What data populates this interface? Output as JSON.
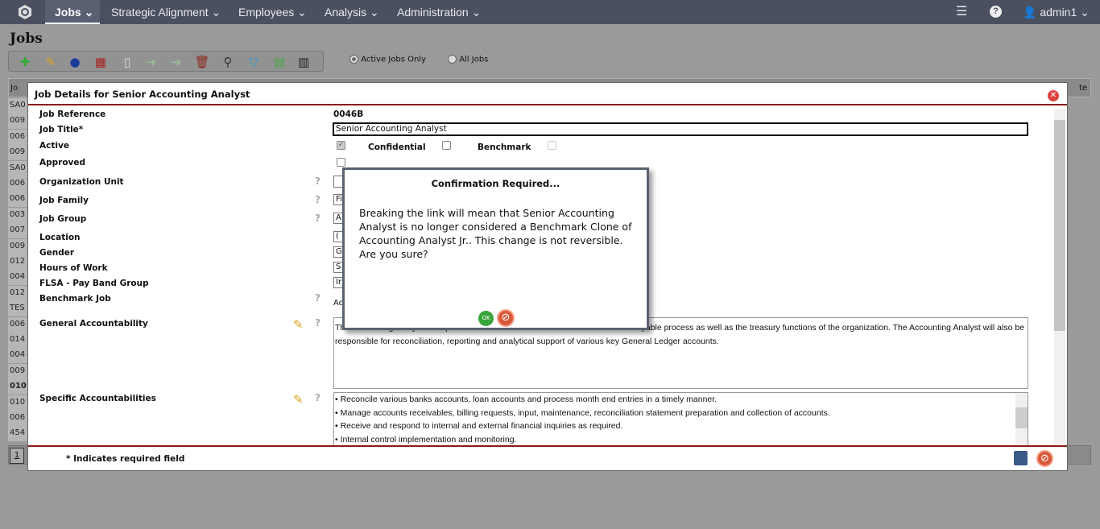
{
  "nav": {
    "items": [
      "Jobs",
      "Strategic Alignment",
      "Employees",
      "Analysis",
      "Administration"
    ],
    "user": "admin1"
  },
  "page": {
    "title": "Jobs",
    "filters": {
      "active": "Active Jobs Only",
      "all": "All Jobs",
      "selected": "Active Jobs Only"
    }
  },
  "toolbar": [
    "add-job",
    "edit",
    "benchmark",
    "questionnaire",
    "copy",
    "import",
    "export",
    "delete",
    "search",
    "filter",
    "print",
    "reports"
  ],
  "grid": {
    "header": "Jo",
    "header_right": "te",
    "rows": [
      "SA0",
      "009",
      "006",
      "009",
      "SA0",
      "006",
      "006",
      "003",
      "007",
      "009",
      "012",
      "004",
      "012",
      "TES",
      "006",
      "014",
      "004",
      "009",
      "010",
      "010",
      "006",
      "454"
    ],
    "pager": "1"
  },
  "modal": {
    "title": "Job Details for Senior Accounting Analyst",
    "fields": {
      "job_reference": {
        "label": "Job Reference",
        "value": "0046B"
      },
      "job_title": {
        "label": "Job Title*",
        "value": "Senior Accounting Analyst"
      },
      "active": {
        "label": "Active",
        "checked": true
      },
      "confidential": {
        "label": "Confidential",
        "checked": false
      },
      "benchmark": {
        "label": "Benchmark",
        "checked": false
      },
      "approved": {
        "label": "Approved",
        "checked": false
      },
      "organization_unit": {
        "label": "Organization Unit",
        "value": ""
      },
      "job_family": {
        "label": "Job Family",
        "value": "Fi"
      },
      "job_group": {
        "label": "Job Group",
        "value": "A"
      },
      "location": {
        "label": "Location",
        "value": "("
      },
      "gender": {
        "label": "Gender",
        "value": "G"
      },
      "hours_of_work": {
        "label": "Hours of Work",
        "value": "S"
      },
      "flsa": {
        "label": "FLSA - Pay Band Group",
        "value": "Ir"
      },
      "benchmark_job": {
        "label": "Benchmark Job",
        "value": "Ac"
      },
      "general_accountability": {
        "label": "General Accountability",
        "value": "The Accounting Analyst is responsible for the Accounts Receivable & Accounts Payable process as well as the treasury functions of the organization. The Accounting Analyst will also be responsible for reconciliation, reporting and analytical support of various key General Ledger accounts."
      },
      "specific_accountabilities": {
        "label": "Specific Accountabilities",
        "items": [
          "• Reconcile various banks accounts, loan accounts and process month end entries in a timely manner.",
          "• Manage accounts receivables, billing requests, input, maintenance, reconciliation statement preparation and collection of accounts.",
          "• Receive and respond to internal and external financial inquiries as required.",
          "• Internal control implementation and monitoring."
        ]
      }
    },
    "footer_note": "* Indicates required field"
  },
  "confirm": {
    "title": "Confirmation Required...",
    "message": "Breaking the link will mean that Senior Accounting Analyst is no longer considered a Benchmark Clone of Accounting Analyst Jr.. This change is not reversible. Are you sure?",
    "ok": "OK"
  },
  "colors": {
    "nav": "#4a5060",
    "accent": "#8b1a1a"
  }
}
